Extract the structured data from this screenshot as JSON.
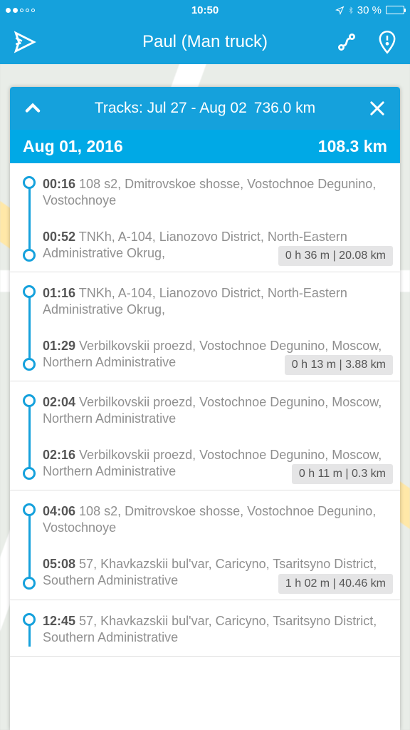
{
  "status_bar": {
    "time": "10:50",
    "battery_pct": "30 %"
  },
  "nav": {
    "title": "Paul (Man truck)"
  },
  "panel": {
    "header_label": "Tracks: Jul 27 - Aug 02",
    "header_km": "736.0 km",
    "date": "Aug 01, 2016",
    "date_km": "108.3 km"
  },
  "segments": [
    {
      "start_time": "00:16",
      "start_addr": "108 s2, Dmitrovskoe shosse, Vostochnoe Degunino, Vostochnoye",
      "end_time": "00:52",
      "end_addr": "TNKh, A-104, Lianozovo District, North-Eastern Administrative Okrug,",
      "badge": "0 h 36 m | 20.08 km"
    },
    {
      "start_time": "01:16",
      "start_addr": "TNKh, A-104, Lianozovo District, North-Eastern Administrative Okrug,",
      "end_time": "01:29",
      "end_addr": "Verbilkovskii proezd, Vostochnoe Degunino, Moscow, Northern Administrative",
      "badge": "0 h 13 m | 3.88 km"
    },
    {
      "start_time": "02:04",
      "start_addr": "Verbilkovskii proezd, Vostochnoe Degunino, Moscow, Northern Administrative",
      "end_time": "02:16",
      "end_addr": "Verbilkovskii proezd, Vostochnoe Degunino, Moscow, Northern Administrative",
      "badge": "0 h 11 m | 0.3 km"
    },
    {
      "start_time": "04:06",
      "start_addr": "108 s2, Dmitrovskoe shosse, Vostochnoe Degunino, Vostochnoye",
      "end_time": "05:08",
      "end_addr": "57, Khavkazskii bul'var, Caricyno, Tsaritsyno District, Southern Administrative",
      "badge": "1 h 02 m | 40.46 km"
    },
    {
      "start_time": "12:45",
      "start_addr": "57, Khavkazskii bul'var, Caricyno, Tsaritsyno District, Southern Administrative",
      "end_time": "",
      "end_addr": "",
      "badge": ""
    }
  ]
}
